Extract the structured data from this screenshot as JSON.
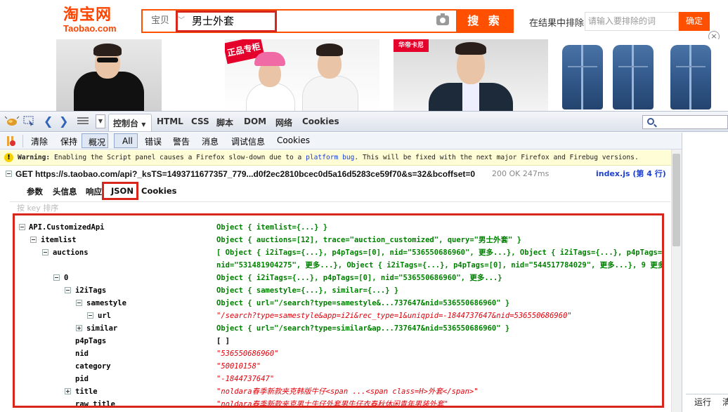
{
  "taobao": {
    "logo_cn": "淘宝网",
    "logo_en": "Taobao.com",
    "search_scope": "宝贝",
    "search_query": "男士外套",
    "search_button": "搜 索",
    "exclude_label": "在结果中排除",
    "exclude_placeholder": "请输入要排除的词",
    "exclude_button": "确定",
    "close_symbol": "×",
    "promo_badge": "正品专柜",
    "brand_badge": "华帝卡尼"
  },
  "firebug": {
    "panel_tabs": [
      "控制台",
      "HTML",
      "CSS",
      "脚本",
      "DOM",
      "网络",
      "Cookies"
    ],
    "console_toolbar": [
      "清除",
      "保持",
      "概况",
      "All",
      "错误",
      "警告",
      "消息",
      "调试信息",
      "Cookies"
    ],
    "warning": {
      "prefix": "Warning:",
      "text_before": " Enabling the Script panel causes a Firefox slow-down due to a ",
      "link": "platform bug",
      "text_after": ". This will be fixed with the next major Firefox and Firebug versions."
    },
    "request": {
      "method_url": "GET https://s.taobao.com/api?_ksTS=1493711677357_779...d0f2ec2810bcec0d5a16d5283ce59f70&s=32&bcoffset=0",
      "status": "200 OK 247ms",
      "source": "index.js (第 4 行)"
    },
    "subtabs": [
      "参数",
      "头信息",
      "响应",
      "JSON",
      "Cookies"
    ],
    "filter_placeholder": "按 key 排序",
    "tree": [
      {
        "key": "API.CustomizedApi",
        "value": "Object { itemlist={...} }"
      },
      {
        "key": "itemlist",
        "value": "Object { auctions=[12], trace=\"auction_customized\", query=\"男士外套\" }"
      },
      {
        "key": "auctions",
        "value": "[ Object { i2iTags={...}, p4pTags=[0], nid=\"536550686960\", 更多...}, Object { i2iTags={...}, p4pTags=[0],",
        "value2": "nid=\"531481904275\", 更多...}, Object { i2iTags={...}, p4pTags=[0], nid=\"544517784029\", 更多...}, 9 更多...]"
      },
      {
        "key": "0",
        "value": "Object { i2iTags={...}, p4pTags=[0], nid=\"536550686960\", 更多...}"
      },
      {
        "key": "i2iTags",
        "value": "Object { samestyle={...}, similar={...} }"
      },
      {
        "key": "samestyle",
        "value": "Object { url=\"/search?type=samestyle&...737647&nid=536550686960\" }"
      },
      {
        "key": "url",
        "value": "\"/search?type=samestyle&app=i2i&rec_type=1&uniqpid=-1844737647&nid=536550686960\""
      },
      {
        "key": "similar",
        "value": "Object { url=\"/search?type=similar&ap...737647&nid=536550686960\" }"
      },
      {
        "key": "p4pTags",
        "value": "[ ]"
      },
      {
        "key": "nid",
        "value": "\"536550686960\""
      },
      {
        "key": "category",
        "value": "\"50010158\""
      },
      {
        "key": "pid",
        "value": "\"-1844737647\""
      },
      {
        "key": "title",
        "value": "\"noldara春季新款夹克韩版牛仔<span ...<span class=H>外套</span>\""
      },
      {
        "key": "raw_title",
        "value": "\"noldara春季新款夹克男士牛仔外套男牛仔衣春秋休闲青年男装外套\""
      }
    ],
    "right_pane": {
      "run": "运行",
      "clear": "清"
    }
  }
}
